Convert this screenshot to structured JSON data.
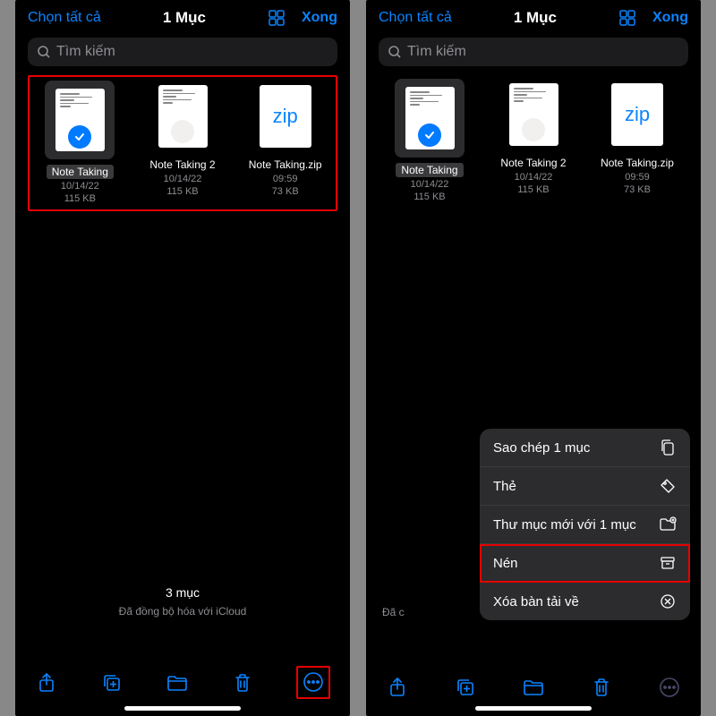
{
  "header": {
    "select_all": "Chọn tất cả",
    "title": "1 Mục",
    "done": "Xong"
  },
  "search": {
    "placeholder": "Tìm kiếm"
  },
  "files": [
    {
      "name": "Note Taking",
      "date": "10/14/22",
      "size": "115 KB",
      "selected": true,
      "type": "doc"
    },
    {
      "name": "Note Taking 2",
      "date": "10/14/22",
      "size": "115 KB",
      "selected": false,
      "type": "doc"
    },
    {
      "name": "Note Taking.zip",
      "date": "09:59",
      "size": "73 KB",
      "selected": false,
      "type": "zip"
    }
  ],
  "zip_badge": "zip",
  "status": {
    "count": "3 mục",
    "sync": "Đã đồng bộ hóa với iCloud",
    "partial": "Đã c"
  },
  "menu": [
    {
      "label": "Sao chép 1 mục",
      "icon": "copy"
    },
    {
      "label": "Thẻ",
      "icon": "tag"
    },
    {
      "label": "Thư mục mới với 1 mục",
      "icon": "folder-plus"
    },
    {
      "label": "Nén",
      "icon": "archive",
      "highlighted": true
    },
    {
      "label": "Xóa bàn tải về",
      "icon": "close-circle"
    }
  ]
}
